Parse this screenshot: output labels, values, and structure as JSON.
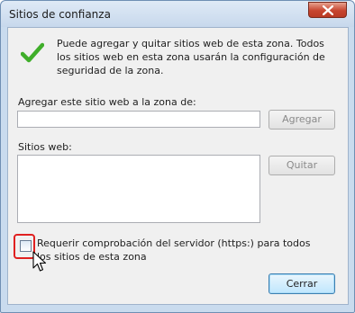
{
  "window": {
    "title": "Sitios de confianza",
    "close_icon": "close-x-icon"
  },
  "info": {
    "icon": "green-checkmark-icon",
    "text": "Puede agregar y quitar sitios web de esta zona. Todos los sitios web en esta zona usarán la configuración de seguridad de la zona."
  },
  "add_site": {
    "label": "Agregar este sitio web a la zona de:",
    "value": "",
    "button_label": "Agregar"
  },
  "websites": {
    "label": "Sitios web:",
    "items": [],
    "remove_button_label": "Quitar"
  },
  "require_https": {
    "label": "Requerir comprobación del servidor (https:) para todos los sitios de esta zona",
    "checked": false
  },
  "footer": {
    "close_button_label": "Cerrar"
  },
  "colors": {
    "highlight": "#e02020",
    "check_green": "#3fae2a"
  }
}
